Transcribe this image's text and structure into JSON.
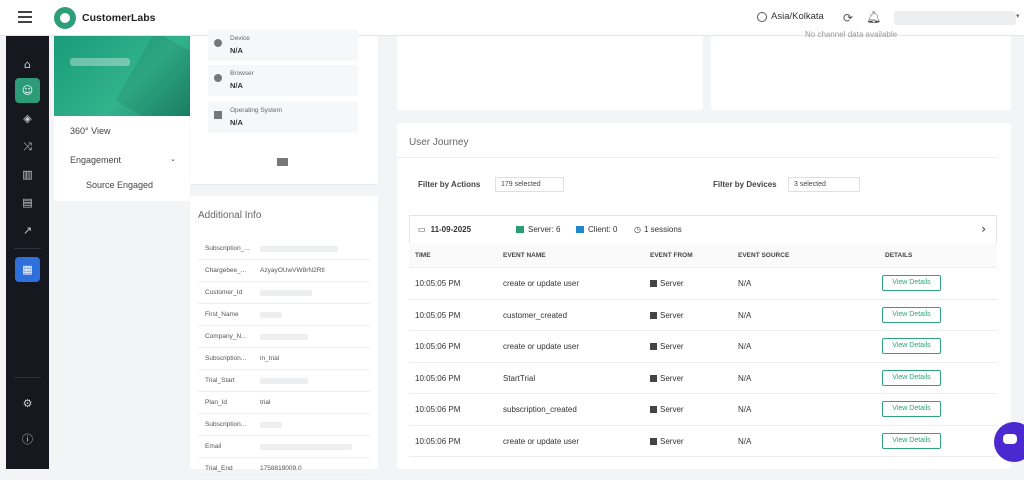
{
  "app": {
    "brand": "CustomerLabs",
    "timezone": "Asia/Kolkata"
  },
  "left_panel": {
    "nav": [
      "360° View",
      "Engagement",
      "Source Engaged"
    ]
  },
  "device_info": [
    {
      "label": "Device",
      "value": "N/A",
      "icon": "device-icon"
    },
    {
      "label": "Browser",
      "value": "N/A",
      "icon": "browser-icon"
    },
    {
      "label": "Operating System",
      "value": "N/A",
      "icon": "os-icon"
    }
  ],
  "additional_info": {
    "title": "Additional Info",
    "rows": [
      {
        "key": "Subscription_...",
        "value": ""
      },
      {
        "key": "Chargebee_...",
        "value": "AzyayOUwVW8rN2Rtl"
      },
      {
        "key": "Customer_Id",
        "value": ""
      },
      {
        "key": "First_Name",
        "value": ""
      },
      {
        "key": "Company_N...",
        "value": ""
      },
      {
        "key": "Subscription...",
        "value": "in_trial"
      },
      {
        "key": "Trial_Start",
        "value": ""
      },
      {
        "key": "Plan_Id",
        "value": "trial"
      },
      {
        "key": "Subscription...",
        "value": ""
      },
      {
        "key": "Email",
        "value": ""
      },
      {
        "key": "Trial_End",
        "value": "1758819009.0"
      }
    ]
  },
  "top_cards": {
    "no_channel_text": "No channel data available"
  },
  "journey": {
    "title": "User Journey",
    "filter_actions_label": "Filter by Actions",
    "filter_actions_value": "179 selected",
    "filter_devices_label": "Filter by Devices",
    "filter_devices_value": "3 selected",
    "session_date": "11-09-2025",
    "server_count": "Server: 6",
    "client_count": "Client: 0",
    "sessions": "1 sessions",
    "columns": [
      "TIME",
      "EVENT NAME",
      "EVENT FROM",
      "EVENT SOURCE",
      "DETAILS"
    ],
    "rows": [
      {
        "time": "10:05:05 PM",
        "event": "create or update user",
        "from": "Server",
        "source": "N/A",
        "details": "View Details"
      },
      {
        "time": "10:05:05 PM",
        "event": "customer_created",
        "from": "Server",
        "source": "N/A",
        "details": "View Details"
      },
      {
        "time": "10:05:06 PM",
        "event": "create or update user",
        "from": "Server",
        "source": "N/A",
        "details": "View Details"
      },
      {
        "time": "10:05:06 PM",
        "event": "StartTrial",
        "from": "Server",
        "source": "N/A",
        "details": "View Details"
      },
      {
        "time": "10:05:06 PM",
        "event": "subscription_created",
        "from": "Server",
        "source": "N/A",
        "details": "View Details"
      },
      {
        "time": "10:05:06 PM",
        "event": "create or update user",
        "from": "Server",
        "source": "N/A",
        "details": "View Details"
      }
    ]
  },
  "colors": {
    "brand_green": "#2c9b77",
    "sidebar_bg": "#15191f",
    "active_blue": "#2f6fdc",
    "chat_purple": "#4a2ad0"
  }
}
